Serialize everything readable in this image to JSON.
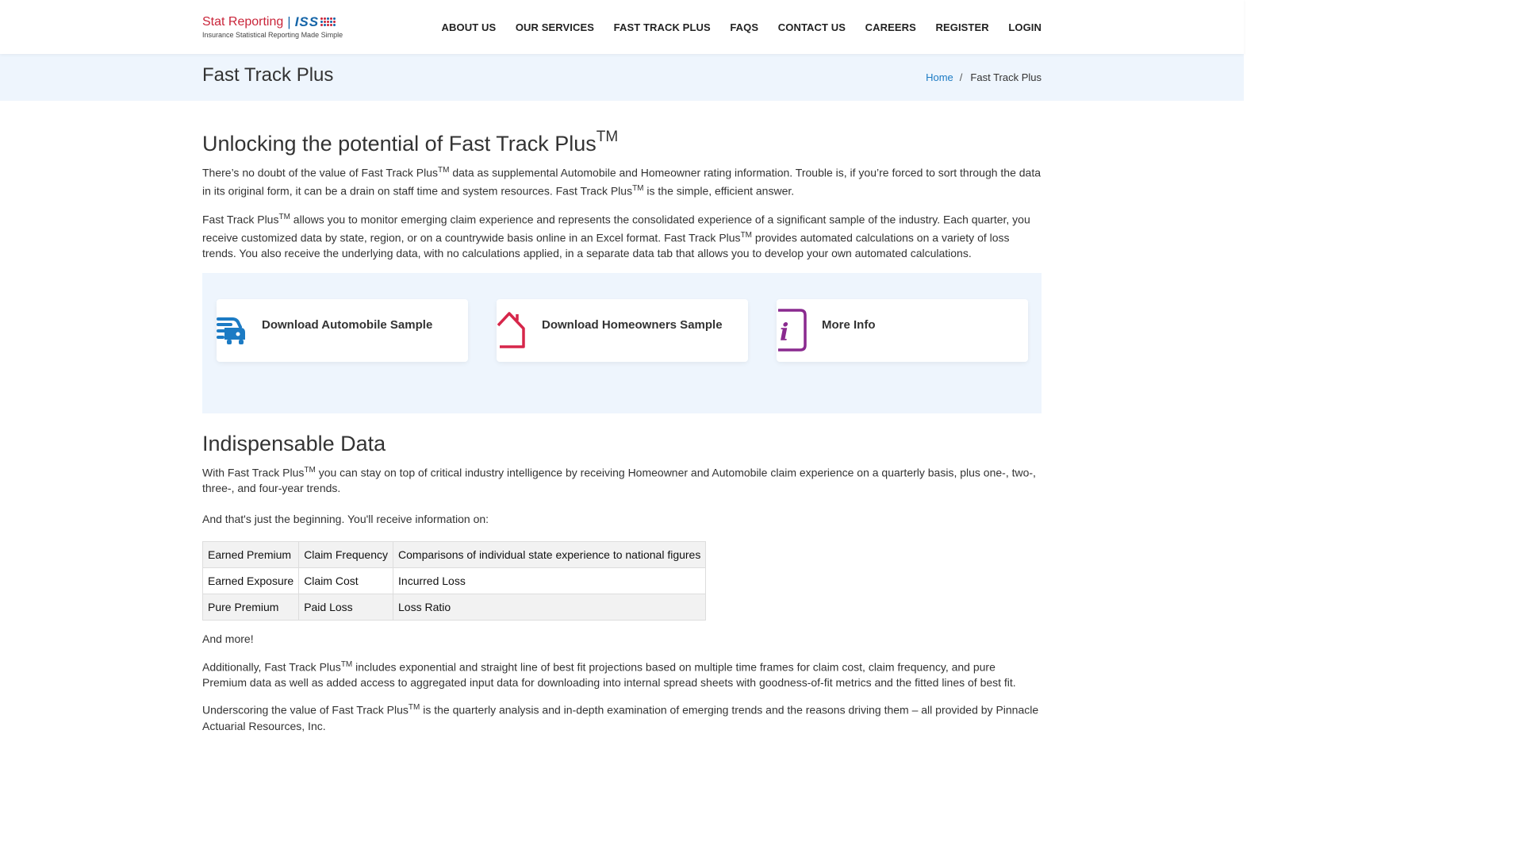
{
  "header": {
    "logo": {
      "brand": "Stat Reporting",
      "separator": "|",
      "iss": "ISS",
      "tagline": "Insurance Statistical Reporting Made Simple"
    },
    "nav": [
      {
        "label": "ABOUT US"
      },
      {
        "label": "OUR SERVICES"
      },
      {
        "label": "FAST TRACK PLUS"
      },
      {
        "label": "FAQS"
      },
      {
        "label": "CONTACT US"
      },
      {
        "label": "CAREERS"
      },
      {
        "label": "REGISTER"
      },
      {
        "label": "LOGIN"
      }
    ]
  },
  "title_band": {
    "title": "Fast Track Plus",
    "breadcrumb": {
      "home": "Home",
      "separator": "/",
      "current": "Fast Track Plus"
    }
  },
  "main": {
    "tm": "TM",
    "heading1": {
      "text": "Unlocking the potential of Fast Track Plus"
    },
    "p1": {
      "a": "There’s no doubt of the value of Fast Track Plus",
      "b": " data as supplemental Automobile and Homeowner rating information. Trouble is, if you’re forced to sort through the data in its original form, it can be a drain on staff time and system resources. Fast Track Plus",
      "c": " is the simple, efficient answer."
    },
    "p2": {
      "a": "Fast Track Plus",
      "b": " allows you to monitor emerging claim experience and represents the consolidated experience of a significant sample of the industry. Each quarter, you receive customized data by state, region, or on a countrywide basis online in an Excel format. Fast Track Plus",
      "c": " provides automated calculations on a variety of loss trends. You also receive the underlying data, with no calculations applied, in a separate data tab that allows you to develop your own automated calculations."
    },
    "cards": [
      {
        "label": "Download Automobile Sample",
        "icon": "car-icon",
        "color": "#1c7bc4"
      },
      {
        "label": "Download Homeowners Sample",
        "icon": "house-icon",
        "color": "#d6264a"
      },
      {
        "label": "More Info",
        "icon": "info-icon",
        "color": "#8a2a8f"
      }
    ],
    "heading2": "Indispensable Data",
    "p3": {
      "a": "With Fast Track Plus",
      "b": " you can stay on top of critical industry intelligence by receiving Homeowner and Automobile claim experience on a quarterly basis, plus one-, two-, three-, and four-year trends."
    },
    "p4": "And that's just the beginning. You'll receive information on:",
    "table": [
      [
        "Earned Premium",
        "Claim Frequency",
        "Comparisons of individual state experience to national figures"
      ],
      [
        "Earned Exposure",
        "Claim Cost",
        "Incurred Loss"
      ],
      [
        "Pure Premium",
        "Paid Loss",
        "Loss Ratio"
      ]
    ],
    "p5": "And more!",
    "p6": {
      "a": "Additionally, Fast Track Plus",
      "b": " includes exponential and straight line of best fit projections based on multiple time frames for claim cost, claim frequency, and pure Premium data as well as added access to aggregated input data for downloading into internal spread sheets with goodness-of-fit metrics and the fitted lines of best fit."
    },
    "p7": {
      "a": "Underscoring the value of Fast Track Plus",
      "b": " is the quarterly analysis and in-depth examination of emerging trends and the reasons driving them – all provided by Pinnacle Actuarial Resources, Inc."
    }
  }
}
